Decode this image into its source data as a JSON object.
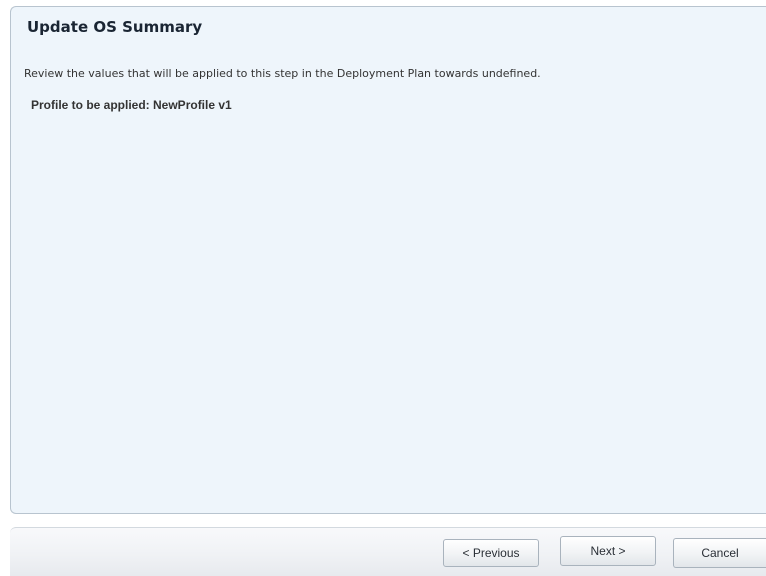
{
  "panel": {
    "title": "Update OS Summary",
    "description": "Review the values that will be applied to this step in the Deployment Plan towards undefined.",
    "profile_line": "Profile to be applied: NewProfile v1"
  },
  "footer": {
    "previous_label": "< Previous",
    "next_label": "Next >",
    "cancel_label": "Cancel"
  }
}
